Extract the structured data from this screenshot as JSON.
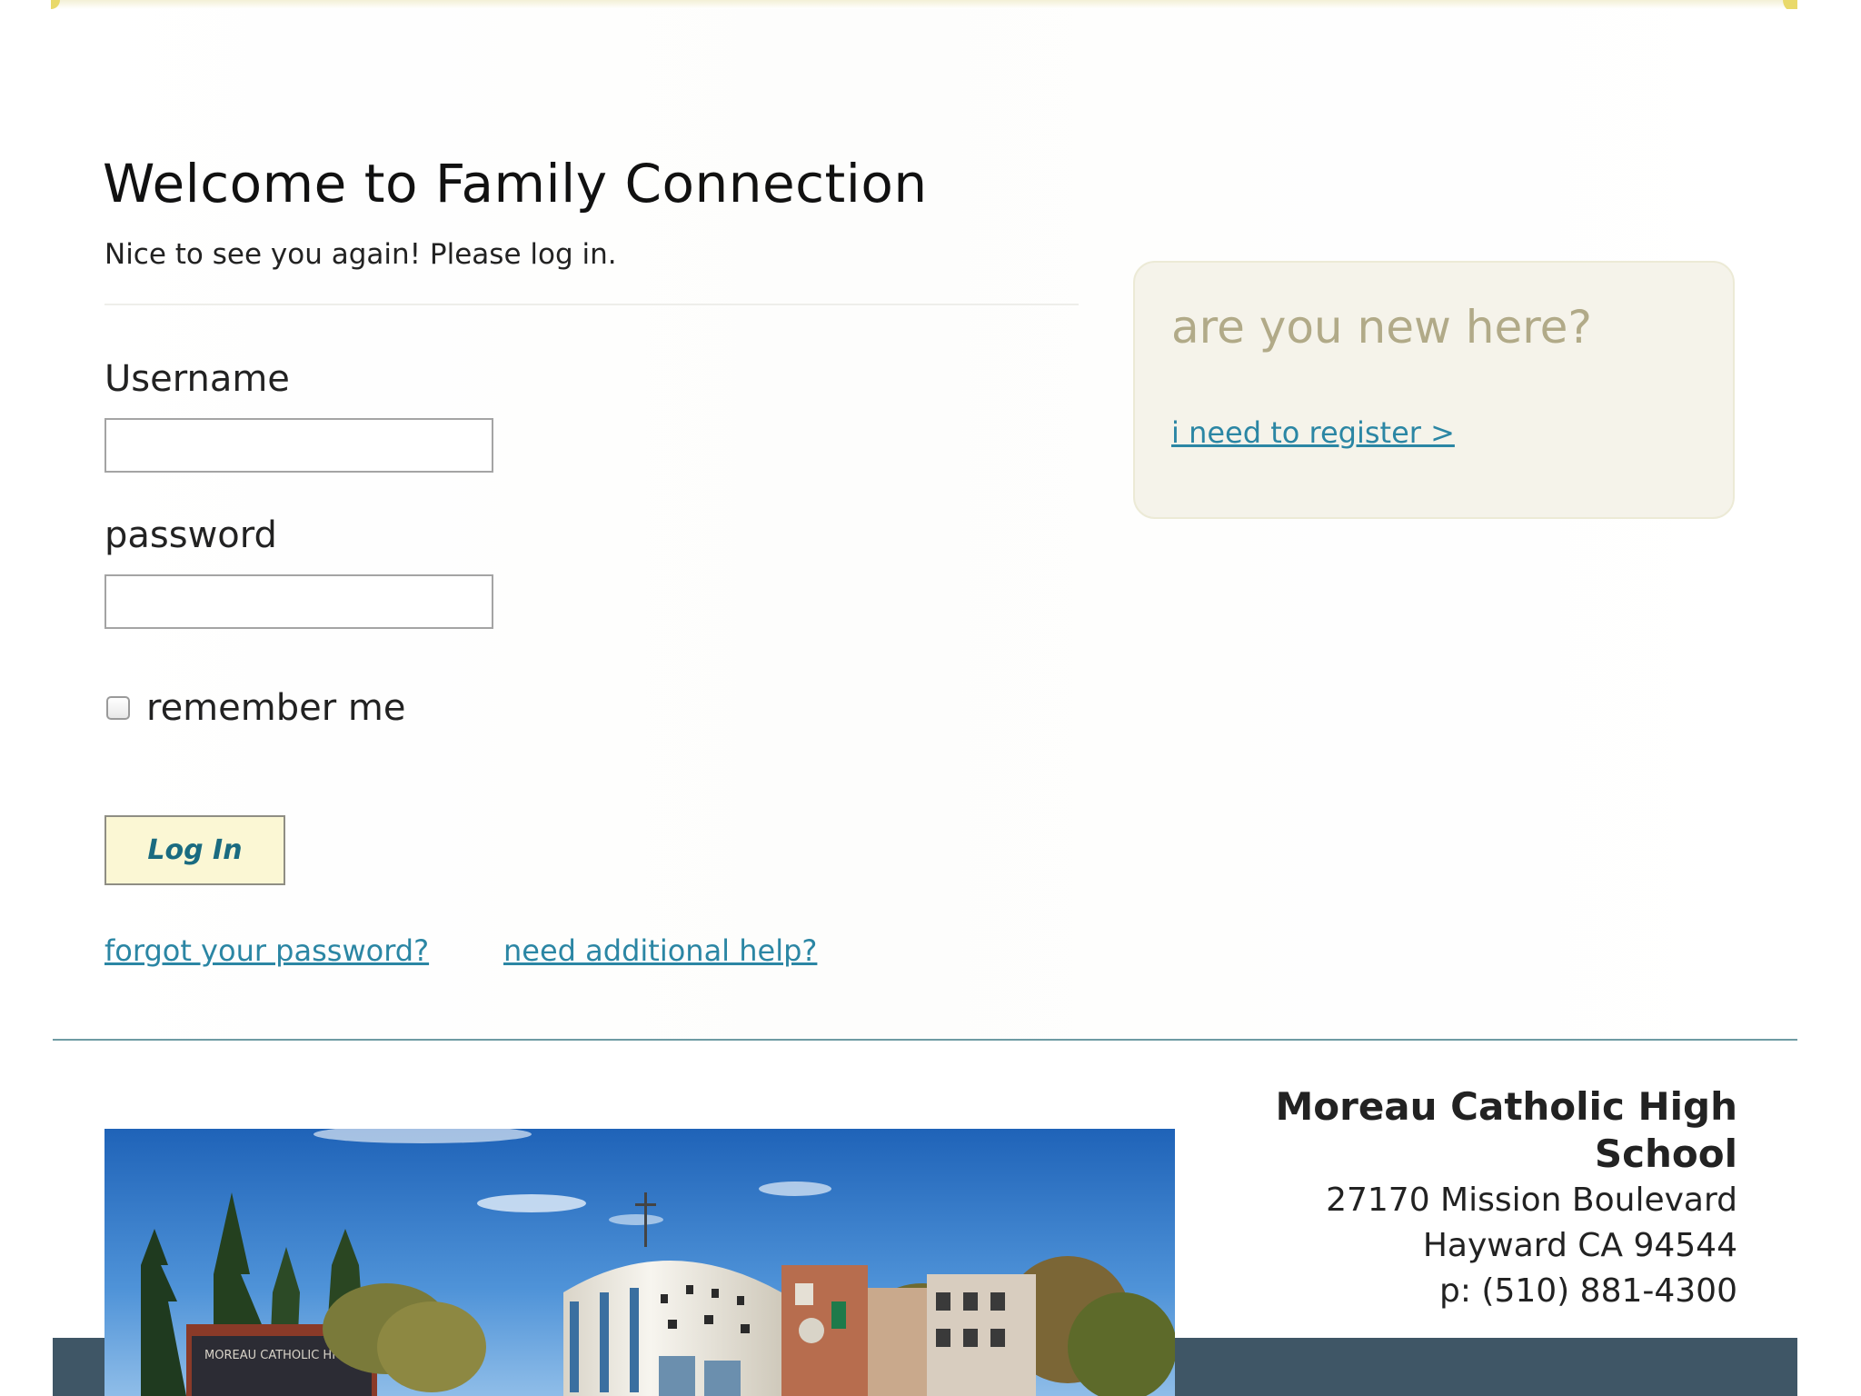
{
  "page": {
    "title": "Welcome to Family Connection",
    "subtitle": "Nice to see you again! Please log in."
  },
  "login_form": {
    "username_label": "Username",
    "username_value": "",
    "password_label": "password",
    "password_value": "",
    "remember_label": "remember me",
    "remember_checked": false,
    "submit_label": "Log In"
  },
  "links": {
    "forgot_password": "forgot your password?",
    "additional_help": "need additional help?"
  },
  "new_here": {
    "heading": "are you new here?",
    "register_link": "i need to register >"
  },
  "school": {
    "name": "Moreau Catholic High School",
    "address_line1": "27170 Mission Boulevard",
    "address_line2": "Hayward CA 94544",
    "phone": "p: (510) 881-4300",
    "photo_sign_text": "MOREAU CATHOLIC HIGH SCHOOL"
  },
  "colors": {
    "link": "#2b86a4",
    "button_bg": "#fbf7d4",
    "button_text": "#1a6b80",
    "new_here_bg": "#f5f3ea",
    "new_here_heading": "#b1aa88",
    "footer_rule": "#6e9ba3",
    "footer_band": "#3f5666",
    "top_accent": "#e9d96a"
  }
}
